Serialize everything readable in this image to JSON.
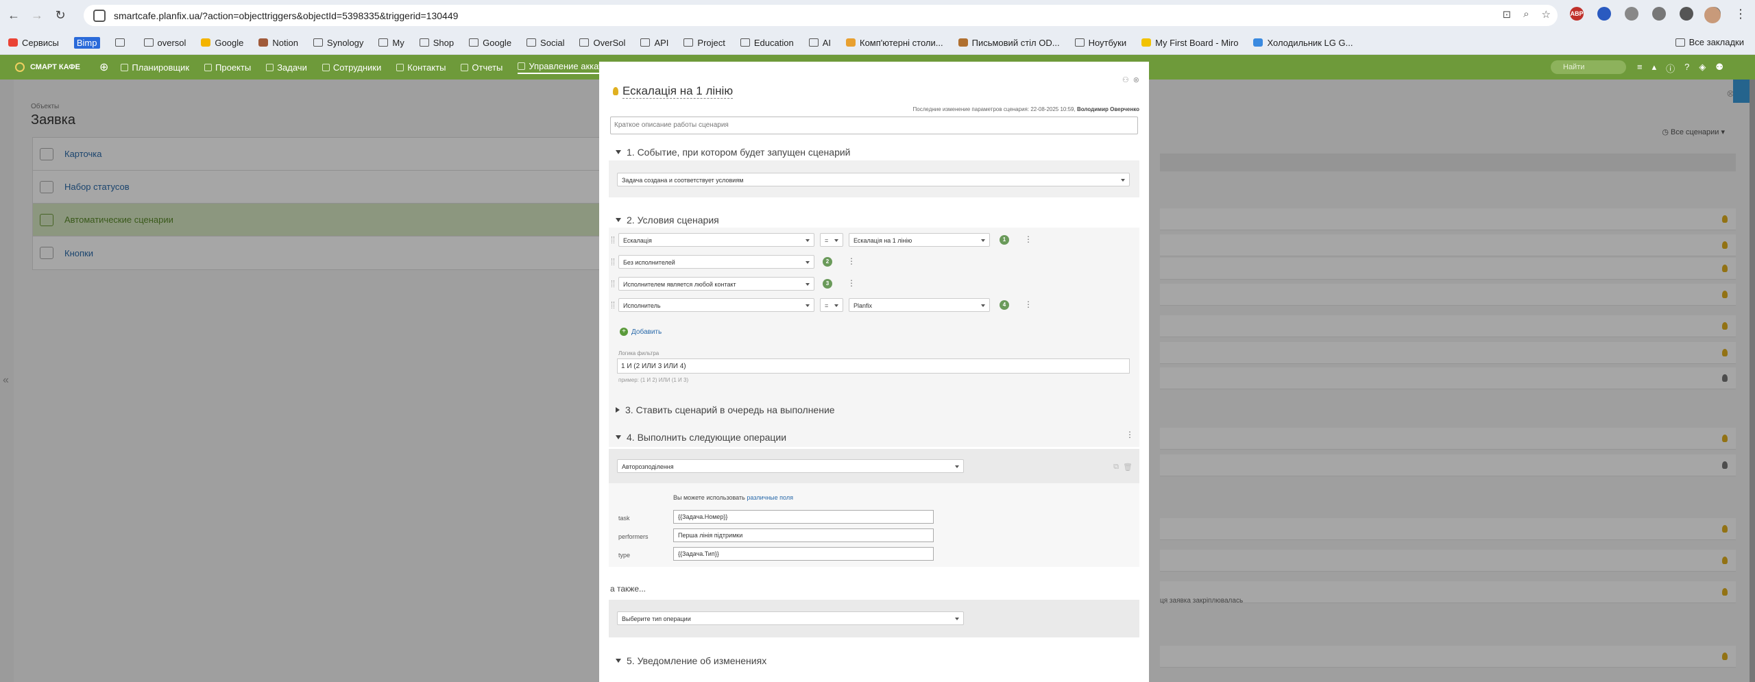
{
  "browser": {
    "url": "smartcafe.planfix.ua/?action=objecttriggers&objectId=5398335&triggerid=130449",
    "bookmarks": [
      "Сервисы",
      "Bimp",
      "oversol",
      "Google",
      "Notion",
      "Synology",
      "My",
      "Shop",
      "Google",
      "Social",
      "OverSol",
      "API",
      "Project",
      "Education",
      "AI",
      "Комп'ютерні столи...",
      "Письмовий стіл OD...",
      "Ноутбуки",
      "My First Board - Miro",
      "Холодильник LG G..."
    ],
    "bookmarks_right": "Все закладки",
    "ext_labels": {
      "abp": "ABP"
    }
  },
  "app": {
    "logo": "СМАРТ КАФЕ",
    "nav": [
      "Планировщик",
      "Проекты",
      "Задачи",
      "Сотрудники",
      "Контакты",
      "Отчеты",
      "Управление аккаунтом"
    ],
    "search_placeholder": "Найти"
  },
  "page": {
    "breadcrumb": "Объекты",
    "title": "Заявка",
    "menu": [
      "Карточка",
      "Набор статусов",
      "Автоматические сценарии",
      "Кнопки"
    ],
    "filter_label": "Все сценарии",
    "row_fragment": "ця заявка закріплювалась"
  },
  "modal": {
    "title": "Ескалація на 1 лінію",
    "modified_prefix": "Последние изменение параметров сценария: 22-08-2025 10:59,",
    "modified_by": "Володимир Оверченко",
    "description_placeholder": "Краткое описание работы сценария",
    "section1": {
      "title": "1. Событие, при котором будет запущен сценарий",
      "event": "Задача создана и соответствует условиям"
    },
    "section2": {
      "title": "2. Условия сценария",
      "conditions": [
        {
          "field": "Ескалація",
          "op": "=",
          "value": "Ескалація на 1 лінію",
          "num": "1"
        },
        {
          "field": "Без исполнителей",
          "num": "2"
        },
        {
          "field": "Исполнителем является любой контакт",
          "num": "3"
        },
        {
          "field": "Исполнитель",
          "op": "=",
          "value": "Planfix",
          "num": "4"
        }
      ],
      "add_label": "Добавить",
      "logic_label": "Логика фильтра",
      "logic_value": "1 И (2 ИЛИ 3 ИЛИ 4)",
      "logic_hint": "пример: (1 И 2) ИЛИ (1 И 3)"
    },
    "section3": {
      "title": "3. Ставить сценарий в очередь на выполнение"
    },
    "section4": {
      "title": "4. Выполнить следующие операции",
      "operation": "Авторозподілення",
      "hint_prefix": "Вы можете использовать",
      "hint_link": "различные поля",
      "params": [
        {
          "label": "task",
          "value": "{{Задача.Номер}}"
        },
        {
          "label": "performers",
          "value": "Перша лінія підтримки"
        },
        {
          "label": "type",
          "value": "{{Задача.Тип}}"
        }
      ],
      "also_label": "а также...",
      "op_type_placeholder": "Выберите тип операции"
    },
    "section5": {
      "title": "5. Уведомление об изменениях"
    }
  }
}
